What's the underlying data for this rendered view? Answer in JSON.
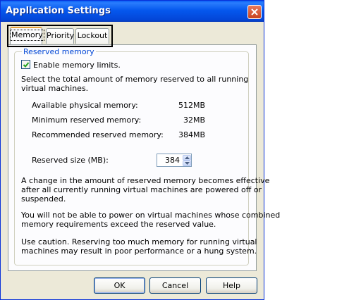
{
  "window": {
    "title": "Application Settings"
  },
  "tabs": [
    {
      "label": "Memory",
      "active": true
    },
    {
      "label": "Priority",
      "active": false
    },
    {
      "label": "Lockout",
      "active": false
    }
  ],
  "group": {
    "title": "Reserved memory",
    "enable_label": "Enable memory limits.",
    "enable_checked": true,
    "description_lines": [
      "Select the total amount of memory reserved to all running",
      "virtual machines."
    ],
    "stats": [
      {
        "label": "Available physical memory:",
        "value": "512MB"
      },
      {
        "label": "Minimum reserved memory:",
        "value": "32MB"
      },
      {
        "label": "Recommended reserved memory:",
        "value": "384MB"
      }
    ],
    "reserved_size_label": "Reserved size (MB):",
    "reserved_size_value": "384",
    "notes": [
      [
        "A change in the amount of reserved memory becomes effective",
        "after all currently running virtual machines are powered off or",
        "suspended."
      ],
      [
        "You will not be able to power on virtual machines whose combined",
        "memory requirements exceed the reserved value."
      ],
      [
        "Use caution. Reserving too much memory for running virtual",
        "machines may result in poor performance or a hung system."
      ]
    ]
  },
  "buttons": {
    "ok": "OK",
    "cancel": "Cancel",
    "help": "Help"
  },
  "icons": {
    "close": "close-icon",
    "check": "checkmark-icon",
    "spin_up": "arrow-up-icon",
    "spin_down": "arrow-down-icon"
  },
  "colors": {
    "titlebar": "#0558ee",
    "group_title": "#0046d5",
    "dialog_bg": "#ece9d8",
    "panel_bg": "#fcfcfe",
    "check": "#21a121",
    "highlight_box": "#000000"
  }
}
